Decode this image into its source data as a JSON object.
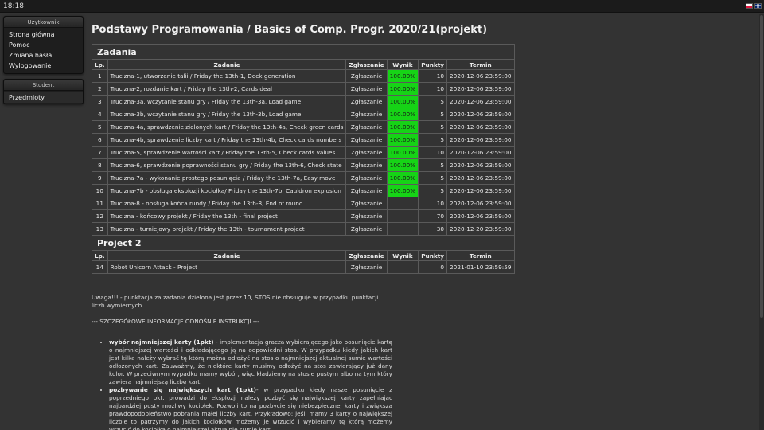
{
  "topbar": {
    "clock": "18:18",
    "lang_pl": "PL",
    "lang_en": "EN"
  },
  "sidebar": {
    "user_panel": {
      "header": "Użytkownik",
      "items": [
        "Strona główna",
        "Pomoc",
        "Zmiana hasła",
        "Wylogowanie"
      ]
    },
    "student_panel": {
      "header": "Student",
      "items": [
        "Przedmioty"
      ]
    }
  },
  "main": {
    "title": "Podstawy Programowania / Basics of Comp. Progr. 2020/21(projekt)",
    "columns": {
      "lp": "Lp.",
      "task": "Zadanie",
      "submit": "Zgłaszanie",
      "result": "Wynik",
      "points": "Punkty",
      "term": "Termin"
    },
    "sections": [
      {
        "title": "Zadania",
        "rows": [
          {
            "lp": "1",
            "task": "Trucizna-1, utworzenie talii / Friday the 13th-1, Deck generation",
            "submit": "Zgłaszanie",
            "result": "100.00%",
            "points": "10",
            "term": "2020-12-06 23:59:00"
          },
          {
            "lp": "2",
            "task": "Trucizna-2, rozdanie kart / Friday the 13th-2, Cards deal",
            "submit": "Zgłaszanie",
            "result": "100.00%",
            "points": "10",
            "term": "2020-12-06 23:59:00"
          },
          {
            "lp": "3",
            "task": "Trucizna-3a, wczytanie stanu gry / Friday the 13th-3a, Load game",
            "submit": "Zgłaszanie",
            "result": "100.00%",
            "points": "5",
            "term": "2020-12-06 23:59:00"
          },
          {
            "lp": "4",
            "task": "Trucizna-3b, wczytanie stanu gry / Friday the 13th-3b, Load game",
            "submit": "Zgłaszanie",
            "result": "100.00%",
            "points": "5",
            "term": "2020-12-06 23:59:00"
          },
          {
            "lp": "5",
            "task": "Trucizna-4a, sprawdzenie zielonych kart / Friday the 13th-4a, Check green cards",
            "submit": "Zgłaszanie",
            "result": "100.00%",
            "points": "5",
            "term": "2020-12-06 23:59:00"
          },
          {
            "lp": "6",
            "task": "Trucizna-4b, sprawdzenie liczby kart / Friday the 13th-4b, Check cards numbers",
            "submit": "Zgłaszanie",
            "result": "100.00%",
            "points": "5",
            "term": "2020-12-06 23:59:00"
          },
          {
            "lp": "7",
            "task": "Trucizna-5, sprawdzenie wartości kart / Friday the 13th-5, Check cards values",
            "submit": "Zgłaszanie",
            "result": "100.00%",
            "points": "10",
            "term": "2020-12-06 23:59:00"
          },
          {
            "lp": "8",
            "task": "Trucizna-6, sprawdzenie poprawności stanu gry / Friday the 13th-6, Check state",
            "submit": "Zgłaszanie",
            "result": "100.00%",
            "points": "5",
            "term": "2020-12-06 23:59:00"
          },
          {
            "lp": "9",
            "task": "Trucizna-7a - wykonanie prostego posunięcia / Friday the 13th-7a, Easy move",
            "submit": "Zgłaszanie",
            "result": "100.00%",
            "points": "5",
            "term": "2020-12-06 23:59:00"
          },
          {
            "lp": "10",
            "task": "Trucizna-7b - obsługa eksplozji kociołka/ Friday the 13th-7b, Cauldron explosion",
            "submit": "Zgłaszanie",
            "result": "100.00%",
            "points": "5",
            "term": "2020-12-06 23:59:00"
          },
          {
            "lp": "11",
            "task": "Trucizna-8 - obsługa końca rundy / Friday the 13th-8, End of round",
            "submit": "Zgłaszanie",
            "result": "",
            "points": "10",
            "term": "2020-12-06 23:59:00"
          },
          {
            "lp": "12",
            "task": "Trucizna - końcowy projekt / Friday the 13th - final project",
            "submit": "Zgłaszanie",
            "result": "",
            "points": "70",
            "term": "2020-12-06 23:59:00"
          },
          {
            "lp": "13",
            "task": "Trucizna - turniejowy projekt / Friday the 13th - tournament project",
            "submit": "Zgłaszanie",
            "result": "",
            "points": "30",
            "term": "2020-12-20 23:59:00"
          }
        ]
      },
      {
        "title": "Project 2",
        "rows": [
          {
            "lp": "14",
            "task": "Robot Unicorn Attack - Project",
            "submit": "Zgłaszanie",
            "result": "",
            "points": "0",
            "term": "2021-01-10 23:59:59"
          }
        ]
      }
    ],
    "result_color": "#16d316"
  },
  "notes": {
    "warning": "Uwaga!!! - punktacja za zadania dzielona jest przez 10, STOS nie obsługuje w przypadku punktacji liczb wymiernych.",
    "details_header": "--- SZCZEGÓŁOWE INFORMACJE ODNOŚNIE INSTRUKCJI ---",
    "bullets": [
      {
        "term": "wybór najmniejszej karty (1pkt)",
        "text": " - implementacja gracza wybierającego jako posunięcie kartę o najmniejszej wartości i odkładającego ją na odpowiedni stos. W przypadku kiedy jakich kart jest kilka należy wybrać tę którą można odłożyć na stos o najmniejszej aktualnej sumie wartości odłożonych kart. Zauważmy, że niektóre karty musimy odłożyć na stos zawierający już dany kolor. W przeciwnym wypadku mamy wybór, więc kładziemy na stosie pustym albo na tym który zawiera najmniejszą liczbę kart."
      },
      {
        "term": "pozbywanie się największych kart (1pkt)",
        "text": "- w przypadku kiedy nasze posunięcie z poprzedniego pkt. prowadzi do eksplozji należy pozbyć się największej karty zapełniając najbardziej pusty możliwy kociołek. Pozwoli to na pozbycie się niebezpiecznej karty i zwiększa prawdopodobieństwo pobrania małej liczby kart. Przykładowo: jeśli mamy 3 karty o największej liczbie to patrzymy do jakich kociołków możemy je wrzucić i wybieramy tę którą możemy wrzucić do kociołka o najmniejszej aktualnie sumie kart."
      }
    ]
  }
}
